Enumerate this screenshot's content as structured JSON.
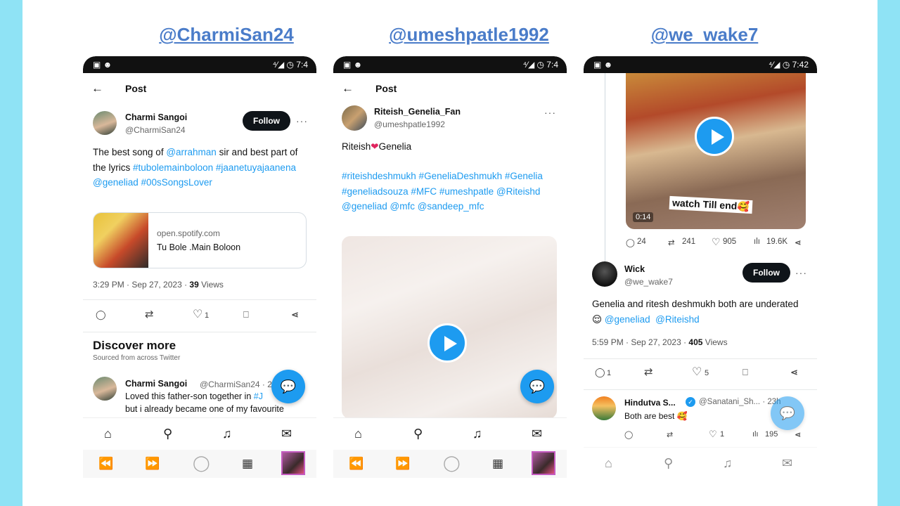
{
  "columns": [
    {
      "title": "@CharmiSan24",
      "status": {
        "left": "▣ ☻",
        "right": "⁴⁄◢ ◷ 7:4"
      },
      "topbar": {
        "back_icon": "←",
        "title": "Post"
      },
      "author": {
        "name": "Charmi Sangoi",
        "handle": "@CharmiSan24",
        "follow": "Follow",
        "more": "···"
      },
      "post": {
        "text_before": "The best song of ",
        "mention1": "@arrahman",
        "text_mid": " sir and best part of the lyrics ",
        "tags": "#tubolemainboloon #jaanetuyajaanena @geneliad #00sSongsLover"
      },
      "linkcard": {
        "domain": "open.spotify.com",
        "title": "Tu Bole .Main Boloon"
      },
      "meta": {
        "time": "3:29 PM · Sep 27, 2023 · ",
        "views_count": "39",
        "views_label": " Views"
      },
      "actions": {
        "reply": "◯",
        "retweet": "⇄",
        "like": "♡",
        "like_count": "1",
        "bookmark": "⎕",
        "share": "⋖"
      },
      "discover": {
        "title": "Discover more",
        "subtitle": "Sourced from across Twitter"
      },
      "reply": {
        "name": "Charmi Sangoi",
        "handle": "@CharmiSan24 · 2",
        "line1_text": "Loved this father-son together in ",
        "line1_link": "#J",
        "line2": "but i already became one of my favourite"
      },
      "nav": {
        "home": "⌂",
        "search": "⚲",
        "bell": "♫",
        "mail": "✉"
      },
      "sys": {
        "rewind": "⏪",
        "forward": "⏩",
        "circle": "◯",
        "gift": "▦"
      }
    },
    {
      "title": "@umeshpatle1992",
      "status": {
        "left": "▣ ☻",
        "right": "⁴⁄◢ ◷ 7:4"
      },
      "topbar": {
        "back_icon": "←",
        "title": "Post"
      },
      "author": {
        "name": "Riteish_Genelia_Fan",
        "handle": "@umeshpatle1992",
        "more": "···"
      },
      "post": {
        "heading_a": "Riteish",
        "heart": "❤",
        "heading_b": "Genelia",
        "tags": "#riteishdeshmukh #GeneliaDeshmukh #Genelia #geneliadsouza #MFC #umeshpatle @Riteishd @geneliad @mfc @sandeep_mfc"
      },
      "nav": {
        "home": "⌂",
        "search": "⚲",
        "bell": "♫",
        "mail": "✉"
      },
      "sys": {
        "rewind": "⏪",
        "forward": "⏩",
        "circle": "◯",
        "gift": "▦"
      }
    },
    {
      "title": "@we_wake7",
      "status": {
        "left": "▣ ☻",
        "right": "⁴⁄◢ ◷ 7:42"
      },
      "video": {
        "caption": "watch Till end🥰",
        "duration": "0:14"
      },
      "stats": {
        "replies": "24",
        "retweets": "241",
        "likes": "905",
        "views": "19.6K"
      },
      "author": {
        "name": "Wick",
        "handle": "@we_wake7",
        "follow": "Follow",
        "more": "···"
      },
      "post": {
        "text": "Genelia and ritesh deshmukh both are underated 😌 ",
        "mention1": "@geneliad",
        "mention2": "@Riteishd"
      },
      "meta": {
        "time": "5:59 PM · Sep 27, 2023 · ",
        "views_count": "405",
        "views_label": " Views"
      },
      "actions": {
        "reply_count": "1",
        "like_count": "5"
      },
      "reply": {
        "name": "Hindutva S...",
        "handle": "@Sanatani_Sh... · 23h",
        "text": "Both are best 🥰",
        "reply_count": "",
        "like_count": "1",
        "views": "195"
      },
      "nav": {
        "home": "⌂",
        "search": "⚲",
        "bell": "♫",
        "mail": "✉"
      }
    }
  ],
  "colors": {
    "link": "#1d9bf0",
    "title": "#4a7cc9",
    "background": "#8fe3f5"
  }
}
